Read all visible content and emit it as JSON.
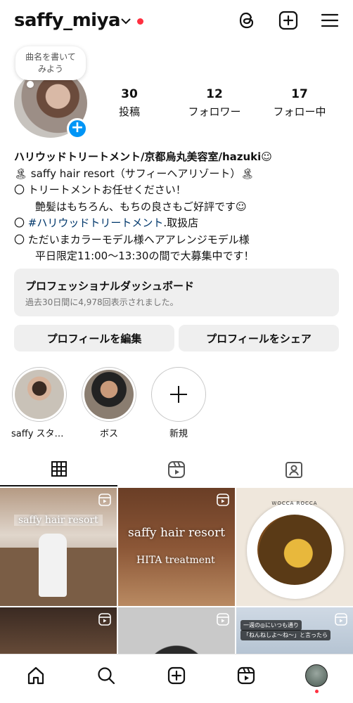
{
  "header": {
    "username": "saffy_miya",
    "chevron": "⌄"
  },
  "note": {
    "text1": "曲名を書いて",
    "text2": "みよう"
  },
  "stats": [
    {
      "num": "30",
      "label": "投稿"
    },
    {
      "num": "12",
      "label": "フォロワー"
    },
    {
      "num": "17",
      "label": "フォロー中"
    }
  ],
  "bio": {
    "name": "ハリウッドトリートメント/京都烏丸美容室/hazuki☺",
    "line1": "🏝 saffy hair resort（サフィーヘアリゾート）🏝",
    "line2": "〇 トリートメントお任せください！",
    "line3": "艶髪はもちろん、もちの良さもご好評です☺",
    "line4_prefix": "〇 ",
    "line4_link": "#ハリウッドトリートメント",
    "line4_suffix": ".取扱店",
    "line5": "〇 ただいまカラーモデル様ヘアアレンジモデル様",
    "line6": "平日限定11:00～13:30の間で大募集中です！"
  },
  "dashboard": {
    "title": "プロフェッショナルダッシュボード",
    "subtitle": "過去30日間に4,978回表示されました。"
  },
  "buttons": {
    "edit": "プロフィールを編集",
    "share": "プロフィールをシェア"
  },
  "highlights": [
    {
      "label": "saffy スタッ…"
    },
    {
      "label": "ボス"
    },
    {
      "label": "新規"
    }
  ],
  "posts": {
    "p1": "saffy hair resort",
    "p2a": "saffy hair resort",
    "p2b": "HITA treatment",
    "p3": "WOCCA ROCCA",
    "p6a": "一週の◎にいつも通り",
    "p6b": "「ねんねしよ～ね～」と言ったら"
  },
  "colors": {
    "accent": "#0095f6",
    "notify": "#ff3040",
    "link": "#00376b"
  }
}
